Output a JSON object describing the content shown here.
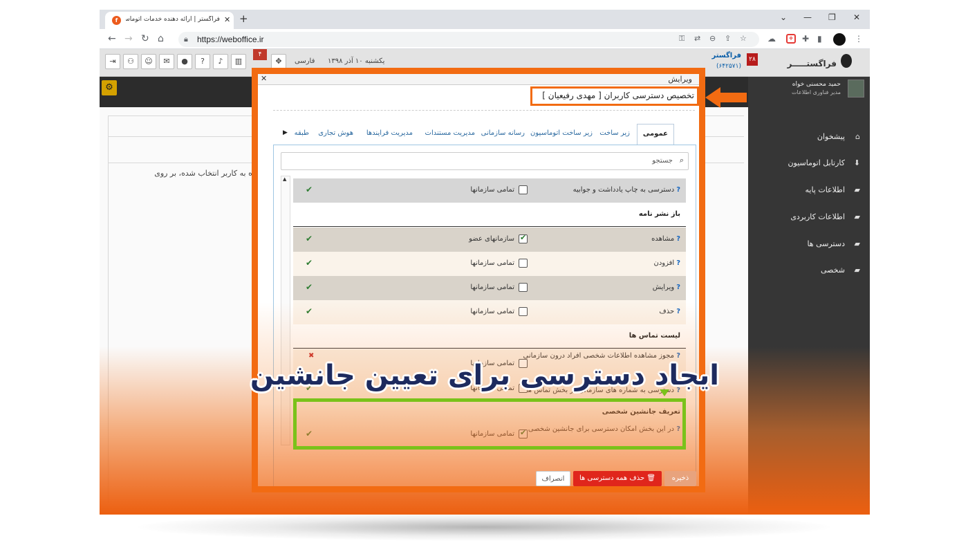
{
  "browser": {
    "tab_title": "فراگستر | ارائه دهنده خدمات اتوماسیون اداری",
    "tab_close": "✕",
    "new_tab": "+",
    "url": "https://weboffice.ir",
    "win_min": "—",
    "win_max": "❐",
    "win_close": "✕"
  },
  "app": {
    "brand": "فراگستـــــر",
    "notif_count": "۴",
    "date": "یکشنبه ۱۰ آذر ۱۳۹۸",
    "language": "فارسی",
    "company": "فراگستر",
    "company_code": "(۶۴۲۵۷۱)",
    "company_badge": "۲۸",
    "user_name": "حمید محسنی خواه",
    "user_role": "مدیر فناوری اطلاعات",
    "background_text": "ماص داده شده به کاربر انتخاب شده، بر روی",
    "sidebar": [
      {
        "label": "پیشخوان",
        "icon": "home-icon"
      },
      {
        "label": "کارتابل اتوماسیون",
        "icon": "inbox-icon"
      },
      {
        "label": "اطلاعات پایه",
        "icon": "folder-icon"
      },
      {
        "label": "اطلاعات کاربردی",
        "icon": "folder-icon"
      },
      {
        "label": "دسترسی ها",
        "icon": "folder-icon"
      },
      {
        "label": "شخصی",
        "icon": "folder-icon"
      }
    ]
  },
  "dialog": {
    "title": "ویرایش",
    "close": "✕",
    "heading": "تخصیص دسترسی کاربران [ مهدی رفیعیان ]",
    "tabs": [
      "عمومی",
      "زیر ساخت",
      "زیر ساخت اتوماسیون",
      "رسانه سازمانی",
      "مدیریت مستندات",
      "مدیریت فرایندها",
      "هوش تجاری",
      "طبقه"
    ],
    "search_placeholder": "جستجو",
    "rows": [
      {
        "type": "item",
        "label": "دسترسی به چاپ یادداشت و جوابیه",
        "scope": "تمامی سازمانها",
        "checked": false,
        "mark": "✔"
      },
      {
        "type": "section",
        "label": "باز نشر نامه"
      },
      {
        "type": "item",
        "label": "مشاهده",
        "scope": "سازمانهای عضو",
        "checked": true,
        "mark": "✔"
      },
      {
        "type": "item",
        "label": "افزودن",
        "scope": "تمامی سازمانها",
        "checked": false,
        "mark": "✔"
      },
      {
        "type": "item",
        "label": "ویرایش",
        "scope": "تمامی سازمانها",
        "checked": false,
        "mark": "✔"
      },
      {
        "type": "item",
        "label": "حذف",
        "scope": "تمامی سازمانها",
        "checked": false,
        "mark": "✔"
      },
      {
        "type": "section",
        "label": "لیست تماس ها"
      },
      {
        "type": "item",
        "label": "مجوز مشاهده اطلاعات شخصی افراد درون سازمانی",
        "scope": "تمامی سازمانها",
        "checked": false,
        "mark": "✖"
      },
      {
        "type": "item",
        "label": "دسترسی به شماره های سازمانی در بخش تماس ها",
        "scope": "تمامی سازمانها",
        "checked": false,
        "mark": "✔"
      },
      {
        "type": "section",
        "label": "تعریف جانشین شخصی"
      },
      {
        "type": "item",
        "label": "در این بخش امکان دسترسی برای جانشین شخصی",
        "scope": "تمامی سازمانها",
        "checked": true,
        "mark": "✔"
      }
    ],
    "save": "ذخیره",
    "delete_all": "حذف همه دسترسی ها",
    "cancel": "انصراف"
  },
  "overlay": {
    "headline": "ایجاد دسترسی برای تعیین جانشین",
    "colors": {
      "orange": "#f26b12",
      "green": "#7ac21a",
      "navy": "#1d2a5e"
    }
  }
}
